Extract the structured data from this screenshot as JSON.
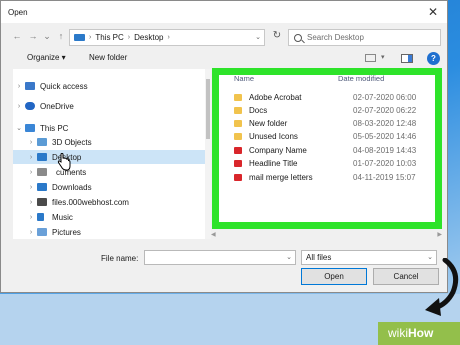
{
  "dialog": {
    "title": "Open",
    "close_glyph": "✕"
  },
  "nav_buttons": {
    "back": "←",
    "forward": "→",
    "recent": "⌄",
    "up": "↑"
  },
  "address": {
    "segments": [
      "This PC",
      "Desktop"
    ],
    "separator": "›"
  },
  "search": {
    "placeholder": "Search Desktop"
  },
  "toolbar": {
    "organize_label": "Organize ▾",
    "new_folder_label": "New folder",
    "help_label": "?"
  },
  "sidebar": {
    "items": [
      {
        "label": "Quick access",
        "icon": "star-icon",
        "color": "#3a78c9",
        "expanded": false
      },
      {
        "label": "OneDrive",
        "icon": "cloud-icon",
        "color": "#2266c4",
        "expanded": false
      },
      {
        "label": "This PC",
        "icon": "computer-icon",
        "color": "#3a86d6",
        "expanded": true
      },
      {
        "label": "3D Objects",
        "icon": "cube-icon",
        "color": "#5b9bd5",
        "expanded": false
      },
      {
        "label": "Desktop",
        "icon": "desktop-icon",
        "color": "#2b79c9",
        "expanded": false,
        "selected": true
      },
      {
        "label": "cuments",
        "icon": "documents-icon",
        "color": "#8a8a8a",
        "expanded": false
      },
      {
        "label": "Downloads",
        "icon": "download-icon",
        "color": "#2b79c9",
        "expanded": false
      },
      {
        "label": "files.000webhost.com",
        "icon": "network-drive-icon",
        "color": "#4a4a4a",
        "expanded": false
      },
      {
        "label": "Music",
        "icon": "music-icon",
        "color": "#2b79c9",
        "expanded": false
      },
      {
        "label": "Pictures",
        "icon": "pictures-icon",
        "color": "#6aa0d8",
        "expanded": false
      }
    ]
  },
  "columns": {
    "name": "Name",
    "date": "Date modified"
  },
  "files": [
    {
      "name": "Adobe Acrobat",
      "date": "02-07-2020 06:00",
      "type": "folder"
    },
    {
      "name": "Docs",
      "date": "02-07-2020 06:22",
      "type": "folder"
    },
    {
      "name": "New folder",
      "date": "08-03-2020 12:48",
      "type": "folder"
    },
    {
      "name": "Unused Icons",
      "date": "05-05-2020 14:46",
      "type": "folder"
    },
    {
      "name": "Company Name",
      "date": "04-08-2019 14:43",
      "type": "pdf"
    },
    {
      "name": "Headline Title",
      "date": "01-07-2020 10:03",
      "type": "pdf"
    },
    {
      "name": "mail merge letters",
      "date": "04-11-2019 15:07",
      "type": "pdf"
    }
  ],
  "footer": {
    "filename_label": "File name:",
    "filename_value": "",
    "filter_value": "All files",
    "open_label": "Open",
    "cancel_label": "Cancel"
  },
  "watermark": {
    "wiki": "wiki",
    "how": "How"
  },
  "colors": {
    "highlight": "#2ee32a",
    "selection": "#cce4f7",
    "accent": "#0078d7"
  }
}
